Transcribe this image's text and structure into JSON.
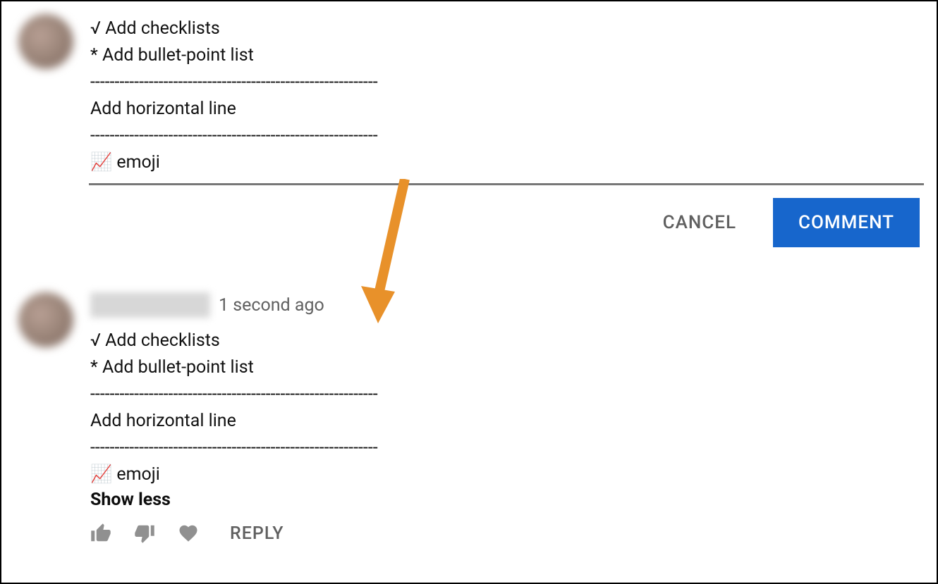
{
  "compose": {
    "lines": [
      "√ Add checklists",
      "* Add bullet-point list",
      "-----------------------------------------------------------",
      "Add horizontal line",
      "-----------------------------------------------------------",
      "📈 emoji"
    ],
    "cancel_label": "CANCEL",
    "submit_label": "COMMENT"
  },
  "posted": {
    "timestamp": "1 second ago",
    "lines": [
      "√ Add checklists",
      "* Add bullet-point list",
      "-----------------------------------------------------------",
      "Add horizontal line",
      "-----------------------------------------------------------",
      "📈 emoji"
    ],
    "show_less_label": "Show less",
    "reply_label": "REPLY"
  },
  "icons": {
    "like": "like-icon",
    "dislike": "dislike-icon",
    "heart": "heart-icon"
  }
}
